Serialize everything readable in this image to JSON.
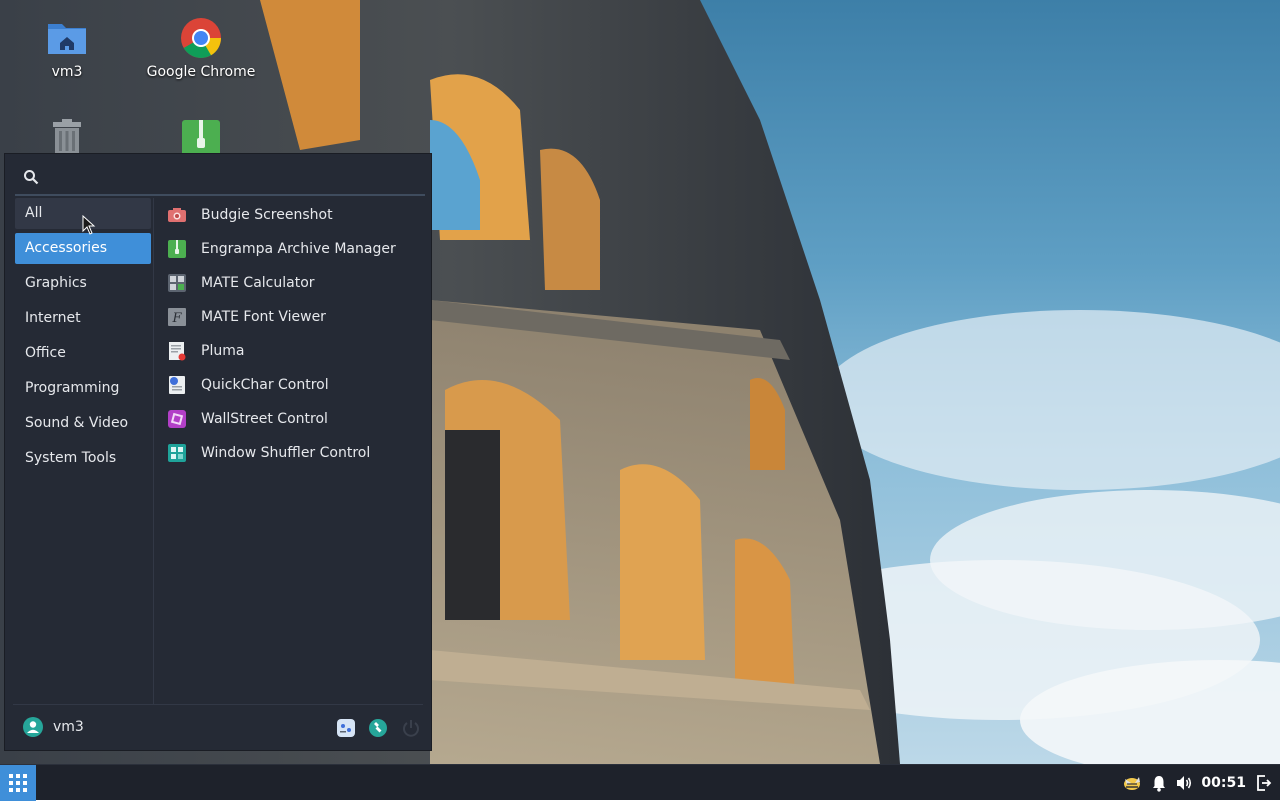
{
  "desktop": {
    "icons": [
      {
        "label": "vm3",
        "icon": "home-folder-icon"
      },
      {
        "label": "Google Chrome",
        "icon": "chrome-icon"
      },
      {
        "label": "",
        "icon": "trash-icon"
      },
      {
        "label": "",
        "icon": "archive-icon"
      }
    ]
  },
  "menu": {
    "search": {
      "value": "",
      "placeholder": ""
    },
    "categories": [
      {
        "label": "All"
      },
      {
        "label": "Accessories"
      },
      {
        "label": "Graphics"
      },
      {
        "label": "Internet"
      },
      {
        "label": "Office"
      },
      {
        "label": "Programming"
      },
      {
        "label": "Sound & Video"
      },
      {
        "label": "System Tools"
      }
    ],
    "active_category": "Accessories",
    "hover_category": "All",
    "apps": [
      {
        "label": "Budgie Screenshot",
        "icon": "camera-icon"
      },
      {
        "label": "Engrampa Archive Manager",
        "icon": "archive-icon"
      },
      {
        "label": "MATE Calculator",
        "icon": "calculator-icon"
      },
      {
        "label": "MATE Font Viewer",
        "icon": "font-icon"
      },
      {
        "label": "Pluma",
        "icon": "text-editor-icon"
      },
      {
        "label": "QuickChar Control",
        "icon": "quickchar-icon"
      },
      {
        "label": "WallStreet Control",
        "icon": "wallstreet-icon"
      },
      {
        "label": "Window Shuffler Control",
        "icon": "window-shuffler-icon"
      }
    ],
    "footer": {
      "user": "vm3",
      "buttons": [
        "settings-icon",
        "system-tools-icon",
        "power-icon"
      ]
    }
  },
  "panel": {
    "clock": "00:51",
    "tray_icons": [
      "budgie-icon",
      "notifications-icon",
      "volume-icon",
      "logout-icon"
    ]
  },
  "colors": {
    "accent": "#3f8fd9",
    "menu_bg": "#252a35",
    "panel_bg": "#1e222b"
  }
}
